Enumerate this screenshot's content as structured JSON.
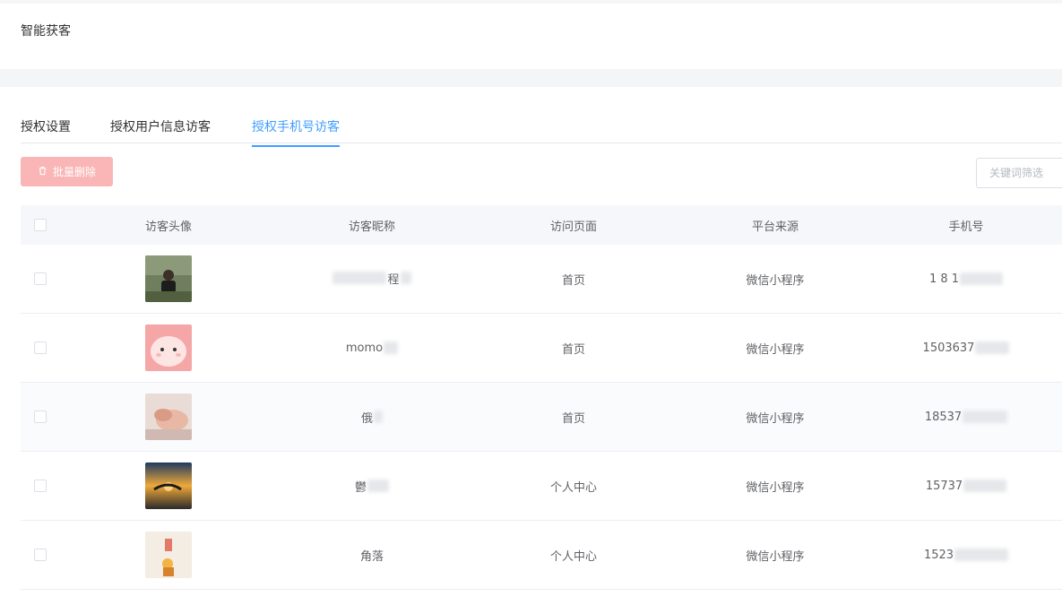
{
  "header": {
    "title": "智能获客"
  },
  "tabs": [
    {
      "label": "授权设置"
    },
    {
      "label": "授权用户信息访客"
    },
    {
      "label": "授权手机号访客"
    }
  ],
  "toolbar": {
    "batch_delete_label": "批量删除",
    "keyword_placeholder": "关键词筛选"
  },
  "table": {
    "columns": [
      "访客头像",
      "访客昵称",
      "访问页面",
      "平台来源",
      "手机号"
    ],
    "rows": [
      {
        "nickname": "程",
        "page": "首页",
        "source": "微信小程序",
        "phone": "1 8 1"
      },
      {
        "nickname": "momo",
        "page": "首页",
        "source": "微信小程序",
        "phone": "1503637"
      },
      {
        "nickname": "俄",
        "page": "首页",
        "source": "微信小程序",
        "phone": "18537"
      },
      {
        "nickname": "鬱",
        "page": "个人中心",
        "source": "微信小程序",
        "phone": "15737"
      },
      {
        "nickname": "角落",
        "page": "个人中心",
        "source": "微信小程序",
        "phone": "1523"
      }
    ]
  },
  "colors": {
    "accent": "#409eff",
    "danger_disabled": "#fab6b6"
  },
  "icons": {
    "batch_delete": "trash-icon"
  }
}
